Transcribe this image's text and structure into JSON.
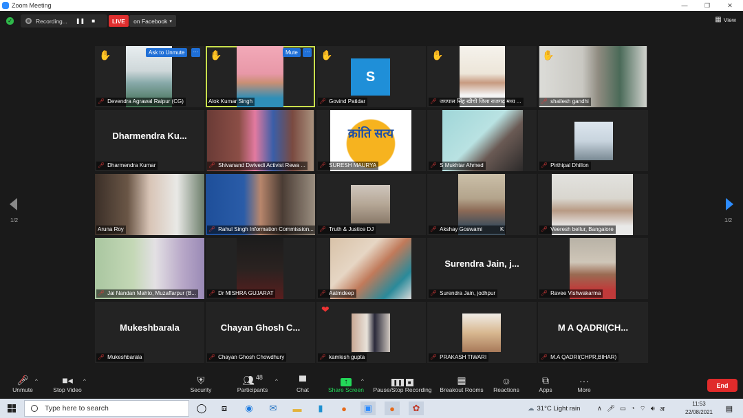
{
  "window": {
    "title": "Zoom Meeting",
    "controls": [
      "—",
      "❐",
      "✕"
    ]
  },
  "topbar": {
    "recording_label": "Recording...",
    "live_label": "LIVE",
    "stream_target": "on Facebook",
    "view_label": "View"
  },
  "pagination": {
    "left": "1/2",
    "right": "1/2"
  },
  "participants": [
    {
      "name": "Devendra Agrawal Raipur (CG)",
      "hand": true,
      "ask_unmute_label": "Ask to Unmute",
      "more_label": "···"
    },
    {
      "name": "Alok Kumar Singh",
      "hand": true,
      "active": true,
      "mute_label": "Mute",
      "more_label": "···"
    },
    {
      "name": "Govind Patidar",
      "hand": true,
      "avatar_letter": "S"
    },
    {
      "name": "जयपाल सिंह खीची जिला राजगढ़ मध्य ...",
      "hand": true
    },
    {
      "name": "shailesh gandhi",
      "hand": true
    },
    {
      "name": "Dharmendra Kumar",
      "display": "Dharmendra  Ku..."
    },
    {
      "name": "Shivanand Dwivedi Activist Rewa ..."
    },
    {
      "name": "SURESH MAURYA",
      "logo_text": "क्रांति सत्य"
    },
    {
      "name": "S Mukhtar Ahmed"
    },
    {
      "name": "Pirthipal Dhillon"
    },
    {
      "name": "Aruna Roy"
    },
    {
      "name": "Rahul Singh Information Commission..."
    },
    {
      "name": "Truth & Justice DJ"
    },
    {
      "name": "Akshay Goswami",
      "extra": "K"
    },
    {
      "name": "Veeresh bellur, Bangalore"
    },
    {
      "name": "Jai Nandan Mahto, Muzaffarpur (B..."
    },
    {
      "name": "Dr MISHRA GUJARAT"
    },
    {
      "name": "Aatmdeep"
    },
    {
      "name": "Surendra Jain, jodhpur",
      "display": "Surendra  Jain,  j..."
    },
    {
      "name": "Ravee Vishwakarma"
    },
    {
      "name": "Mukeshbarala",
      "display": "Mukeshbarala"
    },
    {
      "name": "Chayan Ghosh Chowdhury",
      "display": "Chayan  Ghosh  C..."
    },
    {
      "name": "kamlesh gupta",
      "heart": true
    },
    {
      "name": "PRAKASH TIWARI"
    },
    {
      "name": "M.A QADRI(CHPR,BIHAR)",
      "display": "M  A  QADRI(CH..."
    }
  ],
  "toolbar": {
    "unmute": "Unmute",
    "stop_video": "Stop Video",
    "security": "Security",
    "participants": "Participants",
    "participants_count": "48",
    "chat": "Chat",
    "share_screen": "Share Screen",
    "pause_stop_recording": "Pause/Stop Recording",
    "breakout_rooms": "Breakout Rooms",
    "reactions": "Reactions",
    "apps": "Apps",
    "more": "More",
    "end": "End"
  },
  "taskbar": {
    "search_placeholder": "Type here to search",
    "weather": "31°C  Light rain",
    "time": "11:53",
    "date": "22/08/2021"
  },
  "colors": {
    "accent": "#2d8cff",
    "live": "#e02f2f",
    "end": "#e02b2b",
    "active_speaker": "#c9e04d",
    "share_green": "#23d959",
    "muted_red": "#e23b3b"
  }
}
